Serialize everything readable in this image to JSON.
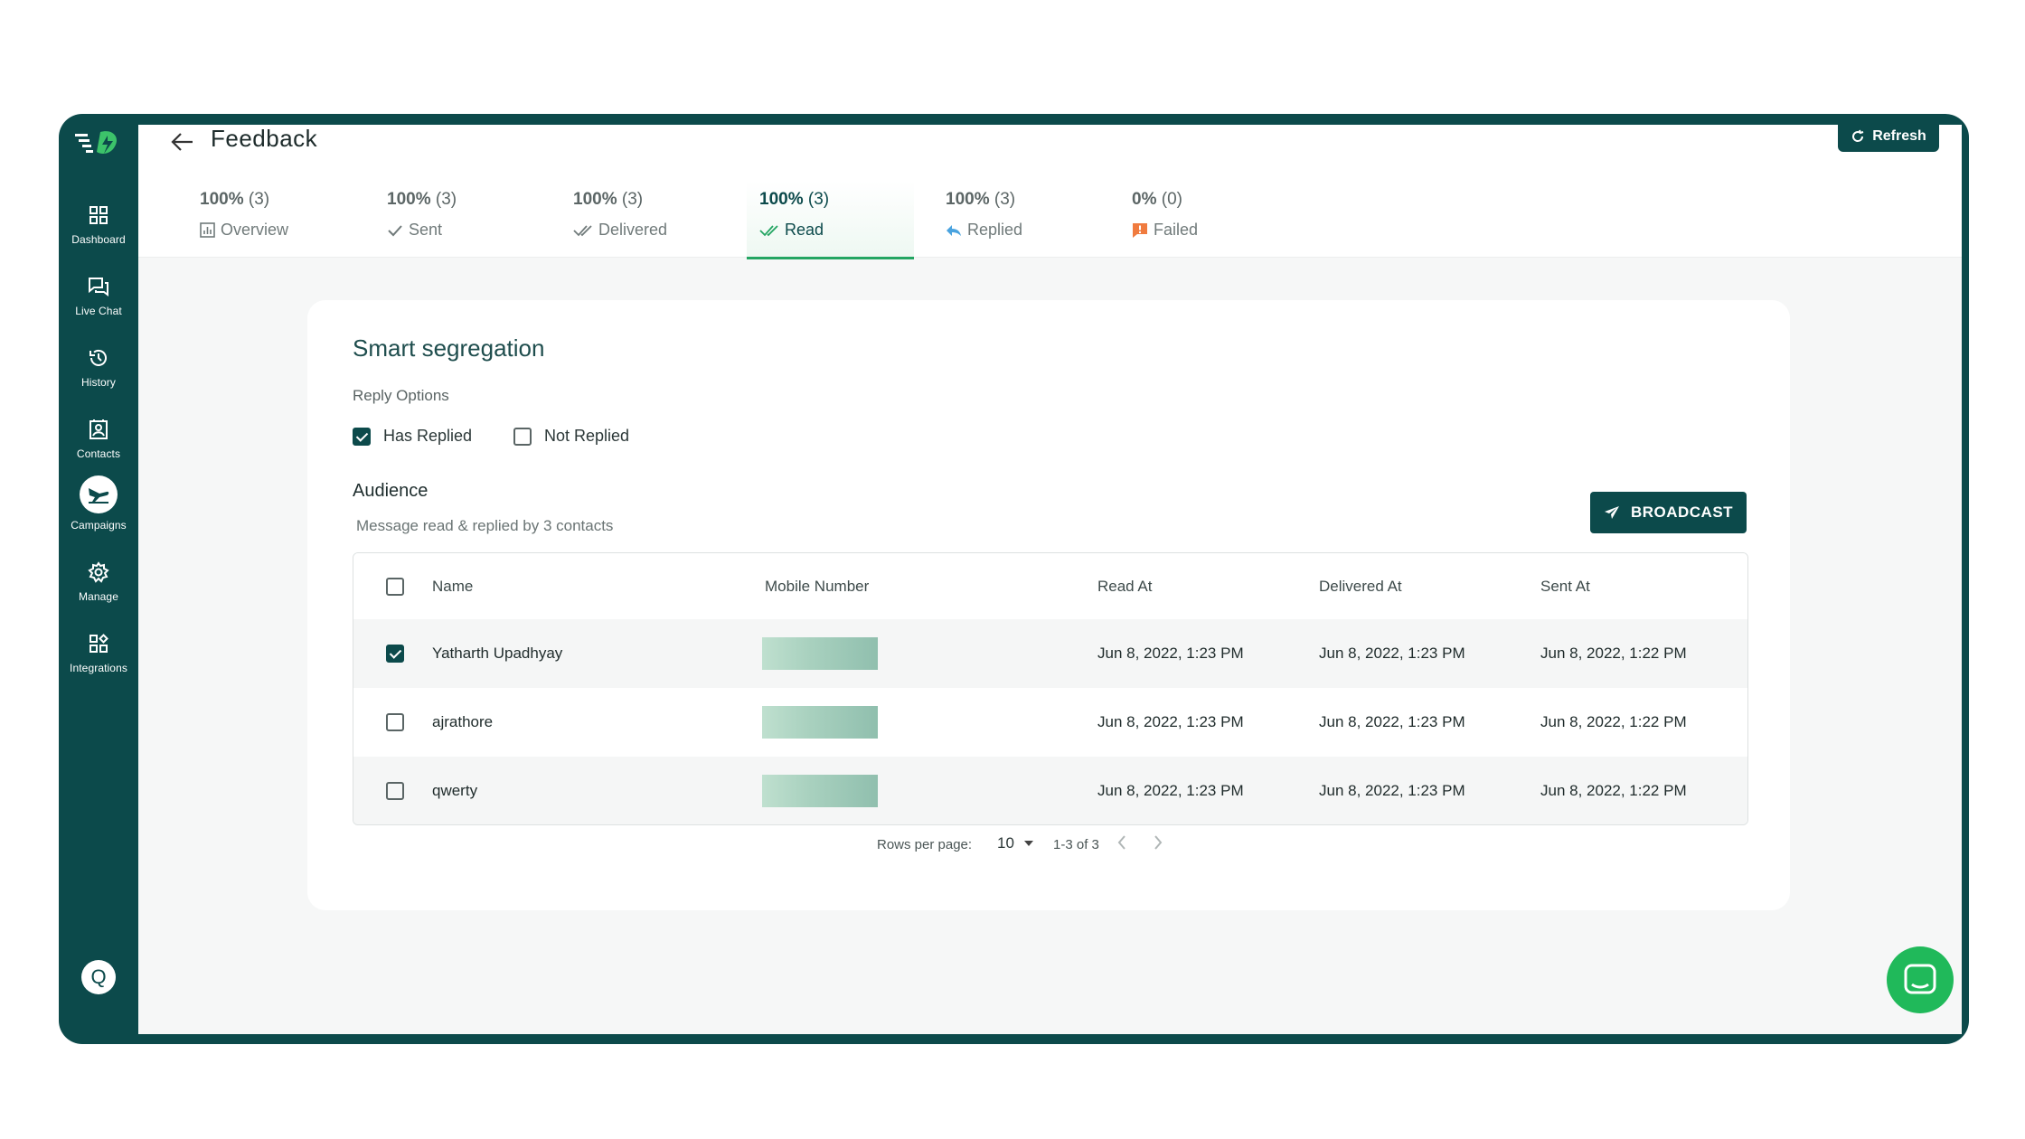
{
  "sidebar": {
    "items": [
      {
        "label": "Dashboard",
        "icon": "dashboard-icon"
      },
      {
        "label": "Live Chat",
        "icon": "chat-icon"
      },
      {
        "label": "History",
        "icon": "history-icon"
      },
      {
        "label": "Contacts",
        "icon": "contacts-icon"
      },
      {
        "label": "Campaigns",
        "icon": "campaigns-icon",
        "active": true
      },
      {
        "label": "Manage",
        "icon": "gear-icon"
      },
      {
        "label": "Integrations",
        "icon": "integrations-icon"
      }
    ],
    "avatar_initial": "Q"
  },
  "header": {
    "title": "Feedback",
    "refresh_label": "Refresh"
  },
  "tabs": [
    {
      "percent": "100%",
      "count": "(3)",
      "label": "Overview",
      "icon": "bar-chart-icon"
    },
    {
      "percent": "100%",
      "count": "(3)",
      "label": "Sent",
      "icon": "check-icon"
    },
    {
      "percent": "100%",
      "count": "(3)",
      "label": "Delivered",
      "icon": "double-check-icon"
    },
    {
      "percent": "100%",
      "count": "(3)",
      "label": "Read",
      "icon": "double-check-green-icon",
      "active": true
    },
    {
      "percent": "100%",
      "count": "(3)",
      "label": "Replied",
      "icon": "reply-icon"
    },
    {
      "percent": "0%",
      "count": "(0)",
      "label": "Failed",
      "icon": "failed-icon"
    }
  ],
  "card": {
    "title": "Smart segregation",
    "reply_options_title": "Reply Options",
    "options": [
      {
        "label": "Has Replied",
        "checked": true
      },
      {
        "label": "Not Replied",
        "checked": false
      }
    ],
    "audience_title": "Audience",
    "audience_subtitle": "Message read & replied by 3 contacts",
    "broadcast_label": "BROADCAST"
  },
  "table": {
    "columns": [
      "Name",
      "Mobile Number",
      "Read At",
      "Delivered At",
      "Sent At"
    ],
    "rows": [
      {
        "name": "Yatharth Upadhyay",
        "read_at": "Jun 8, 2022, 1:23 PM",
        "delivered_at": "Jun 8, 2022, 1:23 PM",
        "sent_at": "Jun 8, 2022, 1:22 PM",
        "checked": true
      },
      {
        "name": "ajrathore",
        "read_at": "Jun 8, 2022, 1:23 PM",
        "delivered_at": "Jun 8, 2022, 1:23 PM",
        "sent_at": "Jun 8, 2022, 1:22 PM",
        "checked": false
      },
      {
        "name": "qwerty",
        "read_at": "Jun 8, 2022, 1:23 PM",
        "delivered_at": "Jun 8, 2022, 1:23 PM",
        "sent_at": "Jun 8, 2022, 1:22 PM",
        "checked": false
      }
    ]
  },
  "pagination": {
    "rows_per_page_label": "Rows per page:",
    "rows_per_page_value": "10",
    "range": "1-3 of 3"
  },
  "colors": {
    "brand": "#0c4a4b",
    "accent_green": "#23a562",
    "chat_fab": "#20b95a"
  }
}
